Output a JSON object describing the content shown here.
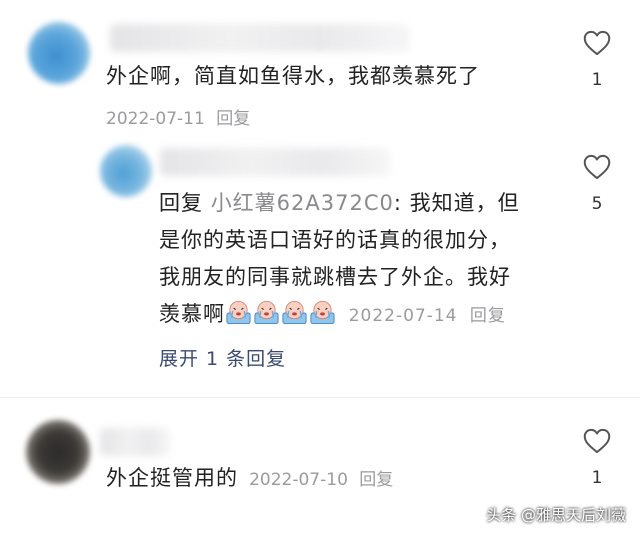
{
  "comments": [
    {
      "text": "外企啊，简直如鱼得水，我都羡慕死了",
      "date": "2022-07-11",
      "reply_label": "回复",
      "likes": "1",
      "avatar_color": "#3f8fcf"
    },
    {
      "reply_prefix": "回复",
      "reply_to": "小红薯62A372C0",
      "text_line1": ": 我知道，但",
      "text_line2": "是你的英语口语好的话真的很加分，",
      "text_line3": "我朋友的同事就跳槽去了外企。我好",
      "text_line4": "羡慕啊",
      "emoji": [
        "crying-face",
        "crying-face",
        "crying-face",
        "crying-face"
      ],
      "date": "2022-07-14",
      "reply_label": "回复",
      "likes": "5",
      "expand_label": "展开 1 条回复",
      "avatar_color": "#4f9fd6"
    },
    {
      "text": "外企挺管用的",
      "date": "2022-07-10",
      "reply_label": "回复",
      "likes": "1",
      "avatar_color": "#2a2a2a"
    }
  ],
  "icons": {
    "like": "heart-outline-icon"
  },
  "watermark": "头条 @雅思天后刘薇"
}
